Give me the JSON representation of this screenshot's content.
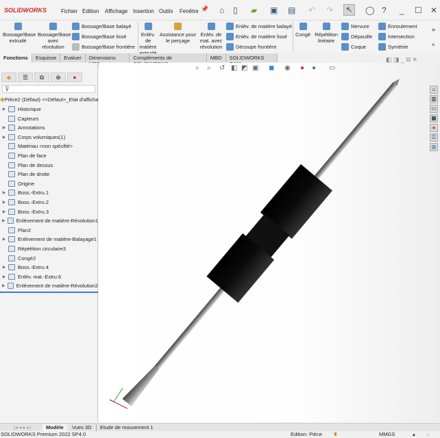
{
  "app": {
    "logo": "SOLIDWORKS"
  },
  "menu": [
    "Fichier",
    "Edition",
    "Affichage",
    "Insertion",
    "Outils",
    "Fenêtre"
  ],
  "ribbon": {
    "extrude": "Bossage/Base extrudé",
    "revolve": "Bossage/Base avec révolution",
    "swept": "Bossage/Base balayé",
    "lofted": "Bossage/Base lissé",
    "boundary": "Bossage/Base frontière",
    "cut_extrude": "Enlév. de matière extrudé",
    "hole": "Assistance pour le perçage",
    "cut_revolve": "Enlév. de mat. avec révolution",
    "cut_swept": "Enlév. de matière balayé",
    "cut_lofted": "Enlév. de matière lissé",
    "cut_boundary": "Découpe frontière",
    "fillet": "Congé",
    "linear_pattern": "Répétition linéaire",
    "rib": "Nervure",
    "draft": "Dépouille",
    "shell": "Coque",
    "wrap": "Enroulement",
    "intersect": "Intersection",
    "mirror": "Symétrie"
  },
  "tabs": [
    "Fonctions",
    "Esquisse",
    "Evaluer",
    "Dimensions MBD",
    "Compléments de SOLIDWORKS",
    "MBD",
    "SOLIDWORKS CAM"
  ],
  "tree": {
    "root": "Pièce2 (Défaut) <<Défaut>_Etat d'affichage 1>",
    "items": [
      {
        "label": "Historique",
        "exp": true
      },
      {
        "label": "Capteurs",
        "exp": false
      },
      {
        "label": "Annotations",
        "exp": true
      },
      {
        "label": "Corps volumiques(1)",
        "exp": true
      },
      {
        "label": "Matériau <non spécifié>",
        "exp": false
      },
      {
        "label": "Plan de face",
        "exp": false
      },
      {
        "label": "Plan de dessus",
        "exp": false
      },
      {
        "label": "Plan de droite",
        "exp": false
      },
      {
        "label": "Origine",
        "exp": false
      },
      {
        "label": "Boss.-Extru.1",
        "exp": true
      },
      {
        "label": "Boss.-Extru.2",
        "exp": true
      },
      {
        "label": "Boss.-Extru.3",
        "exp": true
      },
      {
        "label": "Enlèvement de matière-Révolution1",
        "exp": true
      },
      {
        "label": "Plan2",
        "exp": false
      },
      {
        "label": "Enlèvement de matière-Balayage1",
        "exp": true
      },
      {
        "label": "Répétition circulaire3",
        "exp": false
      },
      {
        "label": "Congé2",
        "exp": false
      },
      {
        "label": "Boss.-Extru.4",
        "exp": true
      },
      {
        "label": "Enlév. mat.-Extru.6",
        "exp": true
      },
      {
        "label": "Enlèvement de matière-Révolution2",
        "exp": true
      }
    ]
  },
  "bottom_tabs": [
    "Modèle",
    "Vues 3D",
    "Etude de mouvement 1"
  ],
  "status": {
    "product": "SOLIDWORKS Premium 2022 SP4.0",
    "mode": "Edition: Pièce",
    "units": "MMGS"
  }
}
